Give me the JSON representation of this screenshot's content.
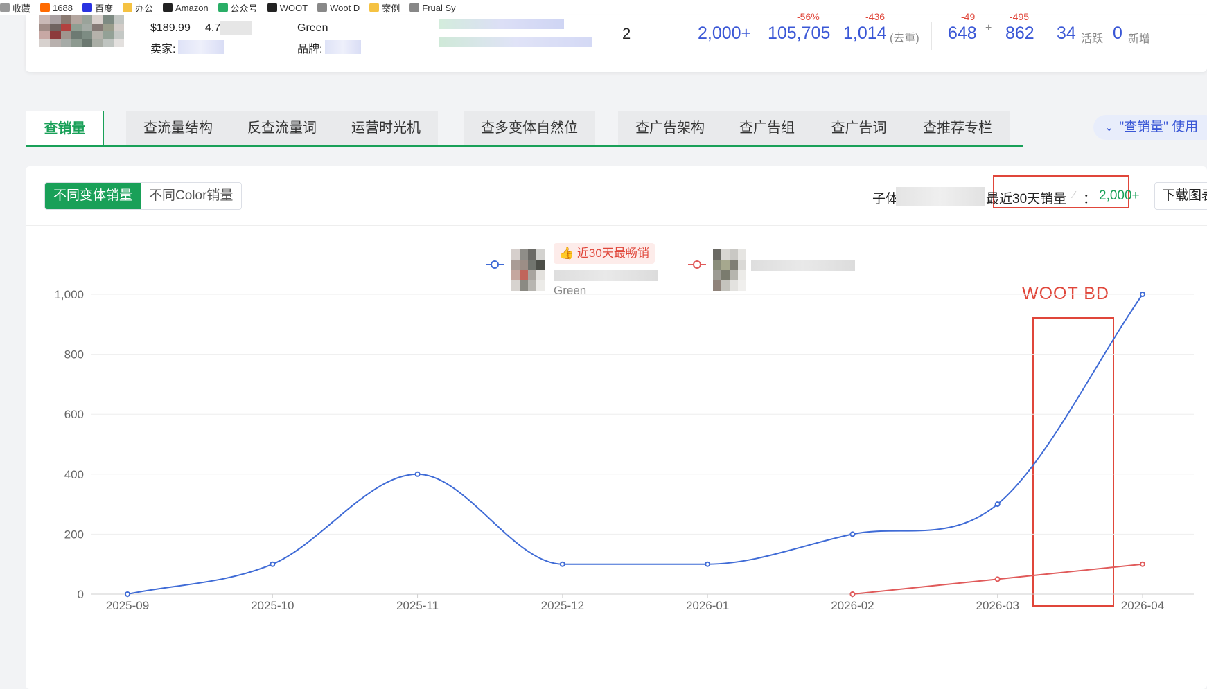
{
  "bookmarks": [
    {
      "label": "收藏",
      "icon": "star-icon",
      "color": "#999999"
    },
    {
      "label": "1688",
      "icon": "1688-icon",
      "color": "#ff6a00"
    },
    {
      "label": "百度",
      "icon": "baidu-icon",
      "color": "#2932e1"
    },
    {
      "label": "办公",
      "icon": "folder-icon",
      "color": "#f5c242"
    },
    {
      "label": "Amazon",
      "icon": "amazon-icon",
      "color": "#222222"
    },
    {
      "label": "公众号",
      "icon": "wechat-icon",
      "color": "#2aae67"
    },
    {
      "label": "WOOT",
      "icon": "amazon-icon",
      "color": "#222222"
    },
    {
      "label": "Woot D",
      "icon": "globe-icon",
      "color": "#888888"
    },
    {
      "label": "案例",
      "icon": "folder-icon",
      "color": "#f5c242"
    },
    {
      "label": "Frual Sy",
      "icon": "globe-icon",
      "color": "#888888"
    }
  ],
  "product": {
    "price": "$189.99",
    "rating": "4.7",
    "color_value": "Green",
    "seller_label": "卖家:",
    "brand_label": "品牌:",
    "variant_count": "2",
    "sales_label": "2,000+",
    "sales_value": "105,705",
    "sales_change": "-56%",
    "reviews_value": "1,014",
    "reviews_note": "(去重)",
    "reviews_change": "-436",
    "ratings_value": "648",
    "ratings_plus": "+",
    "ratings_change": "-49",
    "ratings2_value": "862",
    "ratings2_change": "-495",
    "active_value": "34",
    "active_label": "活跃",
    "new_value": "0",
    "new_label": "新增"
  },
  "tabs": [
    {
      "label": "查销量",
      "active": true
    },
    {
      "label": "查流量结构"
    },
    {
      "label": "反查流量词"
    },
    {
      "label": "运营时光机"
    },
    {
      "label": "查多变体自然位"
    },
    {
      "label": "查广告架构"
    },
    {
      "label": "查广告组"
    },
    {
      "label": "查广告词"
    },
    {
      "label": "查推荐专栏"
    }
  ],
  "usage_hint": "\"查销量\" 使用",
  "panel": {
    "toggle_on": "不同变体销量",
    "toggle_off": "不同Color销量",
    "child_label": "子体",
    "recent_sales_label": "最近30天销量",
    "recent_sales_sep": "：",
    "recent_sales_value": "2,000+",
    "download_label": "下载图表"
  },
  "legend": {
    "badge": "近30天最畅销",
    "variant1_color_text": "Green"
  },
  "annotation": {
    "text": "WOOT BD",
    "color": "#e0463a"
  },
  "colors": {
    "accent_green": "#19a058",
    "series_blue": "#3f6bd6",
    "series_red": "#e05a5a",
    "annotation_red": "#e0463a"
  },
  "chart_data": {
    "type": "line",
    "categories": [
      "2025-09",
      "2025-10",
      "2025-11",
      "2025-12",
      "2026-01",
      "2026-02",
      "2026-03",
      "2026-04"
    ],
    "ylim": [
      0,
      1000
    ],
    "yticks": [
      "0",
      "200",
      "400",
      "600",
      "800",
      "1,000"
    ],
    "smooth": true,
    "grid": true,
    "series": [
      {
        "color": "#3f6bd6",
        "values": [
          0,
          100,
          400,
          100,
          100,
          200,
          300,
          1000
        ]
      },
      {
        "color": "#e05a5a",
        "values": [
          null,
          null,
          null,
          null,
          null,
          0,
          50,
          100
        ]
      }
    ]
  }
}
